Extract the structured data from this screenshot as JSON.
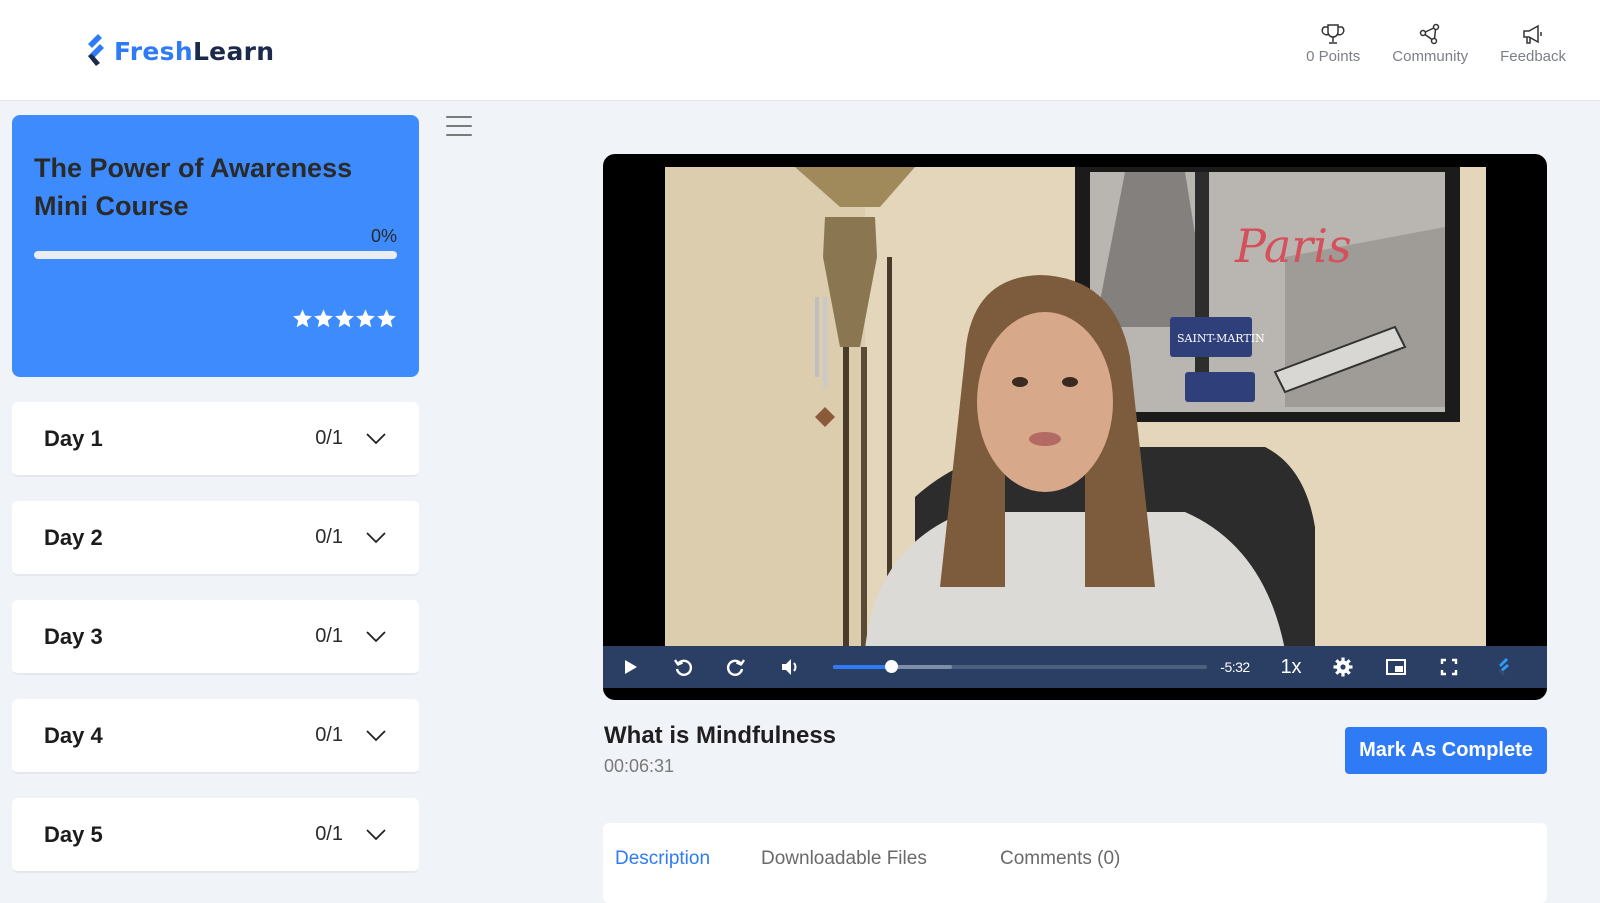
{
  "header": {
    "logo": {
      "part1": "Fresh",
      "part2": "Learn"
    },
    "nav": [
      {
        "icon": "trophy-icon",
        "label": "0 Points"
      },
      {
        "icon": "community-icon",
        "label": "Community"
      },
      {
        "icon": "megaphone-icon",
        "label": "Feedback"
      }
    ]
  },
  "course": {
    "title": "The Power of Awareness Mini Course",
    "progress_label": "0%",
    "progress_percent": 0,
    "rating_stars": 5,
    "star_color": "#ffffff",
    "accent_color": "#3d8bfd"
  },
  "days": [
    {
      "label": "Day 1",
      "count": "0/1"
    },
    {
      "label": "Day 2",
      "count": "0/1"
    },
    {
      "label": "Day 3",
      "count": "0/1"
    },
    {
      "label": "Day 4",
      "count": "0/1"
    },
    {
      "label": "Day 5",
      "count": "0/1"
    }
  ],
  "player": {
    "time_remaining": "-5:32",
    "speed": "1x",
    "played_fraction": 0.156,
    "buffered_fraction": 0.317,
    "controls": [
      "play-icon",
      "rewind-icon",
      "forward-icon",
      "volume-icon",
      "settings-icon",
      "pip-icon",
      "fullscreen-icon",
      "brand-icon"
    ]
  },
  "lesson": {
    "title": "What is Mindfulness",
    "duration": "00:06:31",
    "complete_button": "Mark As Complete"
  },
  "tabs": [
    {
      "label": "Description",
      "active": true
    },
    {
      "label": "Downloadable Files",
      "active": false
    },
    {
      "label": "Comments (0)",
      "active": false
    }
  ]
}
